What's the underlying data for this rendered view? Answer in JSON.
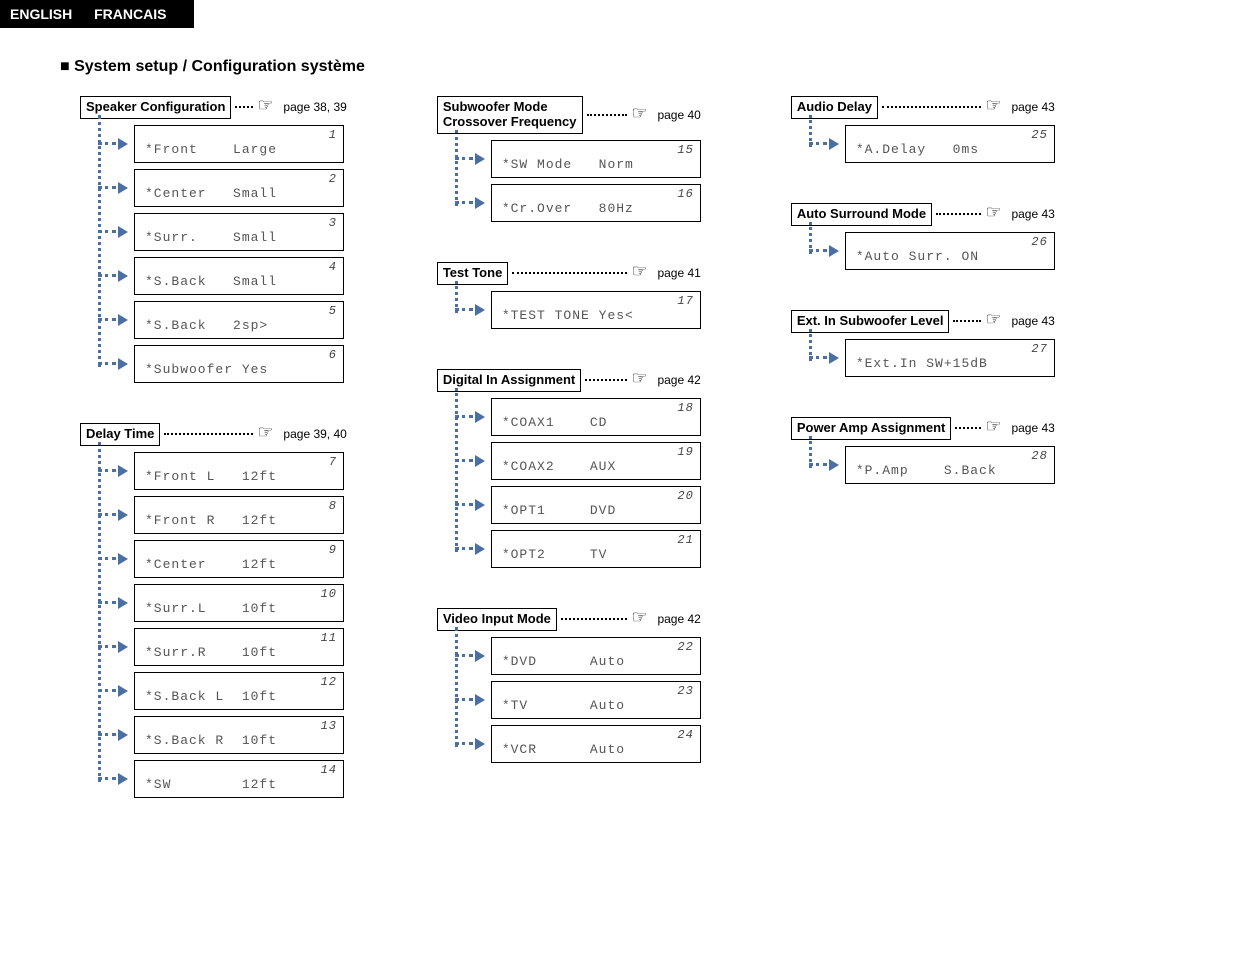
{
  "lang": {
    "english": "ENGLISH",
    "francais": "FRANCAIS"
  },
  "page_title": "■ System setup / Configuration système",
  "sections": {
    "speaker_config": {
      "title": "Speaker Configuration",
      "page": "page 38, 39",
      "items": [
        {
          "num": "1",
          "line": "*Front    Large"
        },
        {
          "num": "2",
          "line": "*Center   Small"
        },
        {
          "num": "3",
          "line": "*Surr.    Small"
        },
        {
          "num": "4",
          "line": "*S.Back   Small"
        },
        {
          "num": "5",
          "line": "*S.Back   2sp>"
        },
        {
          "num": "6",
          "line": "*Subwoofer Yes"
        }
      ]
    },
    "delay_time": {
      "title": "Delay Time",
      "page": "page 39, 40",
      "items": [
        {
          "num": "7",
          "line": "*Front L   12ft"
        },
        {
          "num": "8",
          "line": "*Front R   12ft"
        },
        {
          "num": "9",
          "line": "*Center    12ft"
        },
        {
          "num": "10",
          "line": "*Surr.L    10ft"
        },
        {
          "num": "11",
          "line": "*Surr.R    10ft"
        },
        {
          "num": "12",
          "line": "*S.Back L  10ft"
        },
        {
          "num": "13",
          "line": "*S.Back R  10ft"
        },
        {
          "num": "14",
          "line": "*SW        12ft"
        }
      ]
    },
    "subwoofer": {
      "title": "Subwoofer Mode\nCrossover Frequency",
      "page": "page 40",
      "items": [
        {
          "num": "15",
          "line": "*SW Mode   Norm"
        },
        {
          "num": "16",
          "line": "*Cr.Over   80Hz"
        }
      ]
    },
    "test_tone": {
      "title": "Test Tone",
      "page": "page 41",
      "items": [
        {
          "num": "17",
          "line": "*TEST TONE Yes<"
        }
      ]
    },
    "digital_in": {
      "title": "Digital In Assignment",
      "page": "page 42",
      "items": [
        {
          "num": "18",
          "line": "*COAX1    CD"
        },
        {
          "num": "19",
          "line": "*COAX2    AUX"
        },
        {
          "num": "20",
          "line": "*OPT1     DVD"
        },
        {
          "num": "21",
          "line": "*OPT2     TV"
        }
      ]
    },
    "video_input": {
      "title": "Video Input Mode",
      "page": "page 42",
      "items": [
        {
          "num": "22",
          "line": "*DVD      Auto"
        },
        {
          "num": "23",
          "line": "*TV       Auto"
        },
        {
          "num": "24",
          "line": "*VCR      Auto"
        }
      ]
    },
    "audio_delay": {
      "title": "Audio Delay",
      "page": "page 43",
      "items": [
        {
          "num": "25",
          "line": "*A.Delay   0ms"
        }
      ]
    },
    "auto_surr": {
      "title": "Auto Surround Mode",
      "page": "page 43",
      "items": [
        {
          "num": "26",
          "line": "*Auto Surr. ON"
        }
      ]
    },
    "ext_in": {
      "title": "Ext. In Subwoofer Level",
      "page": "page 43",
      "items": [
        {
          "num": "27",
          "line": "*Ext.In SW+15dB"
        }
      ]
    },
    "power_amp": {
      "title": "Power Amp Assignment",
      "page": "page 43",
      "items": [
        {
          "num": "28",
          "line": "*P.Amp    S.Back"
        }
      ]
    }
  }
}
